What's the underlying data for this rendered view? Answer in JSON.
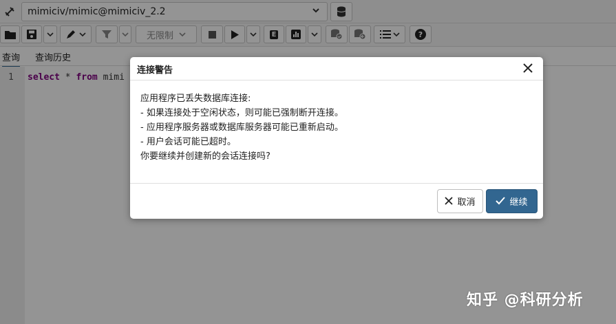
{
  "connection": {
    "current": "mimiciv/mimic@mimiciv_2.2"
  },
  "toolbar": {
    "limit_label": "无限制",
    "explain_label": "E"
  },
  "tabs": [
    {
      "label": "查询"
    },
    {
      "label": "查询历史"
    }
  ],
  "editor": {
    "line_number": "1",
    "code_keyword1": "select",
    "code_middle": " * ",
    "code_keyword2": "from",
    "code_rest": " mimi"
  },
  "dialog": {
    "title": "连接警告",
    "close_glyph": "✕",
    "lines": [
      "应用程序已丢失数据库连接:",
      "- 如果连接处于空闲状态，则可能已强制断开连接。",
      "- 应用程序服务器或数据库服务器可能已重新启动。",
      "- 用户会话可能已超时。",
      "你要继续并创建新的会话连接吗?"
    ],
    "cancel_label": "取消",
    "continue_label": "继续",
    "cancel_icon": "close-icon",
    "continue_icon": "check-icon"
  },
  "watermark": "知乎 @科研分析",
  "colors": {
    "primary": "#326690",
    "overlay": "rgba(0,0,0,0.42)"
  }
}
